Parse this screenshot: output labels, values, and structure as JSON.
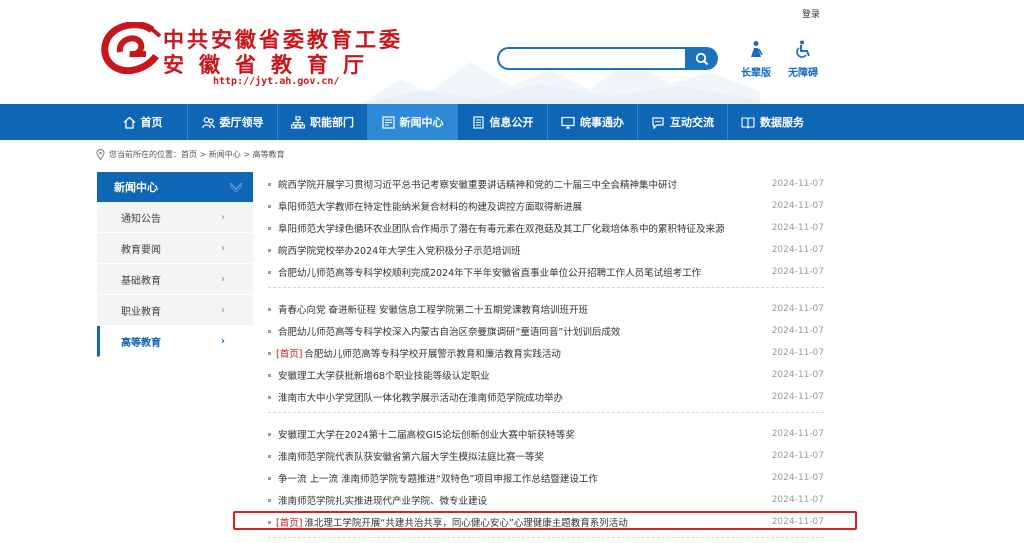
{
  "header": {
    "login": "登录",
    "title_line1": "中共安徽省委教育工委",
    "title_line2": "安徽省教育厅",
    "url": "http://jyt.ah.gov.cn/",
    "search_placeholder": "",
    "tools": [
      {
        "label": "长辈版",
        "icon": "elder-icon"
      },
      {
        "label": "无障碍",
        "icon": "accessibility-icon"
      }
    ],
    "brand_color": "#c8161d",
    "nav_color": "#0f66b4"
  },
  "nav": [
    {
      "label": "首页",
      "icon": "home-icon"
    },
    {
      "label": "委厅领导",
      "icon": "leaders-icon"
    },
    {
      "label": "职能部门",
      "icon": "org-icon"
    },
    {
      "label": "新闻中心",
      "icon": "news-icon",
      "active": true
    },
    {
      "label": "信息公开",
      "icon": "info-icon"
    },
    {
      "label": "皖事通办",
      "icon": "service-icon"
    },
    {
      "label": "互动交流",
      "icon": "chat-icon"
    },
    {
      "label": "数据服务",
      "icon": "data-icon"
    }
  ],
  "breadcrumb": {
    "text": "您当前所在的位置：首页 > 新闻中心 > 高等教育"
  },
  "sidebar": {
    "title": "新闻中心",
    "items": [
      {
        "label": "通知公告"
      },
      {
        "label": "教育要闻"
      },
      {
        "label": "基础教育"
      },
      {
        "label": "职业教育"
      },
      {
        "label": "高等教育",
        "active": true
      }
    ]
  },
  "news": {
    "groups": [
      [
        {
          "tag": "",
          "title": "皖西学院开展学习贯彻习近平总书记考察安徽重要讲话精神和党的二十届三中全会精神集中研讨",
          "date": "2024-11-07"
        },
        {
          "tag": "",
          "title": "阜阳师范大学教师在特定性能纳米复合材料的构建及调控方面取得新进展",
          "date": "2024-11-07"
        },
        {
          "tag": "",
          "title": "阜阳师范大学绿色循环农业团队合作揭示了潜在有毒元素在双孢菇及其工厂化栽培体系中的累积特征及来源",
          "date": "2024-11-07"
        },
        {
          "tag": "",
          "title": "皖西学院党校举办2024年大学生入党积极分子示范培训班",
          "date": "2024-11-07"
        },
        {
          "tag": "",
          "title": "合肥幼儿师范高等专科学校顺利完成2024年下半年安徽省直事业单位公开招聘工作人员笔试组考工作",
          "date": "2024-11-07"
        }
      ],
      [
        {
          "tag": "",
          "title": "青春心向党 奋进新征程 安徽信息工程学院第二十五期党课教育培训班开班",
          "date": "2024-11-07"
        },
        {
          "tag": "",
          "title": "合肥幼儿师范高等专科学校深入内蒙古自治区奈曼旗调研“童语同音”计划训后成效",
          "date": "2024-11-07"
        },
        {
          "tag": "[首页]",
          "title": "合肥幼儿师范高等专科学校开展警示教育和廉洁教育实践活动",
          "date": "2024-11-07"
        },
        {
          "tag": "",
          "title": "安徽理工大学获批新增68个职业技能等级认定职业",
          "date": "2024-11-07"
        },
        {
          "tag": "",
          "title": "淮南市大中小学党团队一体化教学展示活动在淮南师范学院成功举办",
          "date": "2024-11-07"
        }
      ],
      [
        {
          "tag": "",
          "title": "安徽理工大学在2024第十二届高校GIS论坛创新创业大赛中斩获特等奖",
          "date": "2024-11-07"
        },
        {
          "tag": "",
          "title": "淮南师范学院代表队获安徽省第六届大学生模拟法庭比赛一等奖",
          "date": "2024-11-07"
        },
        {
          "tag": "",
          "title": "争一流 上一流 淮南师范学院专题推进“双特色”项目申报工作总结暨建设工作",
          "date": "2024-11-07"
        },
        {
          "tag": "",
          "title": "淮南师范学院扎实推进现代产业学院、微专业建设",
          "date": "2024-11-07"
        },
        {
          "tag": "[首页]",
          "title": "淮北理工学院开展“共建共治共享，同心健心安心”心理健康主题教育系列活动",
          "date": "2024-11-07"
        }
      ]
    ]
  }
}
